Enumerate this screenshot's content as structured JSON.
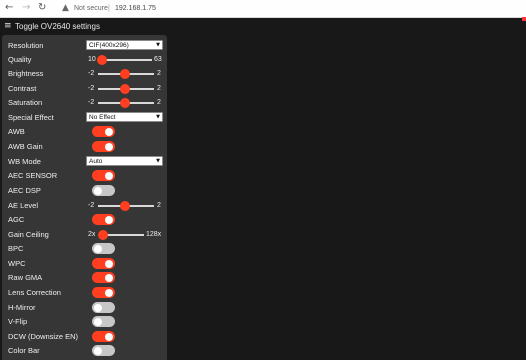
{
  "browser": {
    "back_glyph": "←",
    "forward_glyph": "→",
    "reload_glyph": "↻",
    "warning_glyph": "▲",
    "security_label": "Not secure",
    "separator": "|",
    "url": "192.168.1.75"
  },
  "header": {
    "menu_glyph": "≡",
    "toggle_label": "Toggle OV2640 settings"
  },
  "colors": {
    "accent": "#ff3f1f",
    "panel": "#363636",
    "page_background": "#181818"
  },
  "settings": {
    "resolution": {
      "label": "Resolution",
      "value": "CIF(400x296)",
      "arrow": "▼"
    },
    "quality": {
      "label": "Quality",
      "min": "10",
      "max": "63",
      "value": 10
    },
    "brightness": {
      "label": "Brightness",
      "min": "-2",
      "max": "2",
      "value": 0
    },
    "contrast": {
      "label": "Contrast",
      "min": "-2",
      "max": "2",
      "value": 0
    },
    "saturation": {
      "label": "Saturation",
      "min": "-2",
      "max": "2",
      "value": 0
    },
    "special_effect": {
      "label": "Special Effect",
      "value": "No Effect",
      "arrow": "▼"
    },
    "awb": {
      "label": "AWB",
      "on": true
    },
    "awb_gain": {
      "label": "AWB Gain",
      "on": true
    },
    "wb_mode": {
      "label": "WB Mode",
      "value": "Auto",
      "arrow": "▼"
    },
    "aec_sensor": {
      "label": "AEC SENSOR",
      "on": true
    },
    "aec_dsp": {
      "label": "AEC DSP",
      "on": false
    },
    "ae_level": {
      "label": "AE Level",
      "min": "-2",
      "max": "2",
      "value": 0
    },
    "agc": {
      "label": "AGC",
      "on": true
    },
    "gain_ceiling": {
      "label": "Gain Ceiling",
      "min": "2x",
      "max": "128x",
      "value_fraction": 0
    },
    "bpc": {
      "label": "BPC",
      "on": false
    },
    "wpc": {
      "label": "WPC",
      "on": true
    },
    "raw_gma": {
      "label": "Raw GMA",
      "on": true
    },
    "lens_correction": {
      "label": "Lens Correction",
      "on": true
    },
    "h_mirror": {
      "label": "H-Mirror",
      "on": false
    },
    "v_flip": {
      "label": "V-Flip",
      "on": false
    },
    "dcw": {
      "label": "DCW (Downsize EN)",
      "on": true
    },
    "color_bar": {
      "label": "Color Bar",
      "on": false
    }
  }
}
